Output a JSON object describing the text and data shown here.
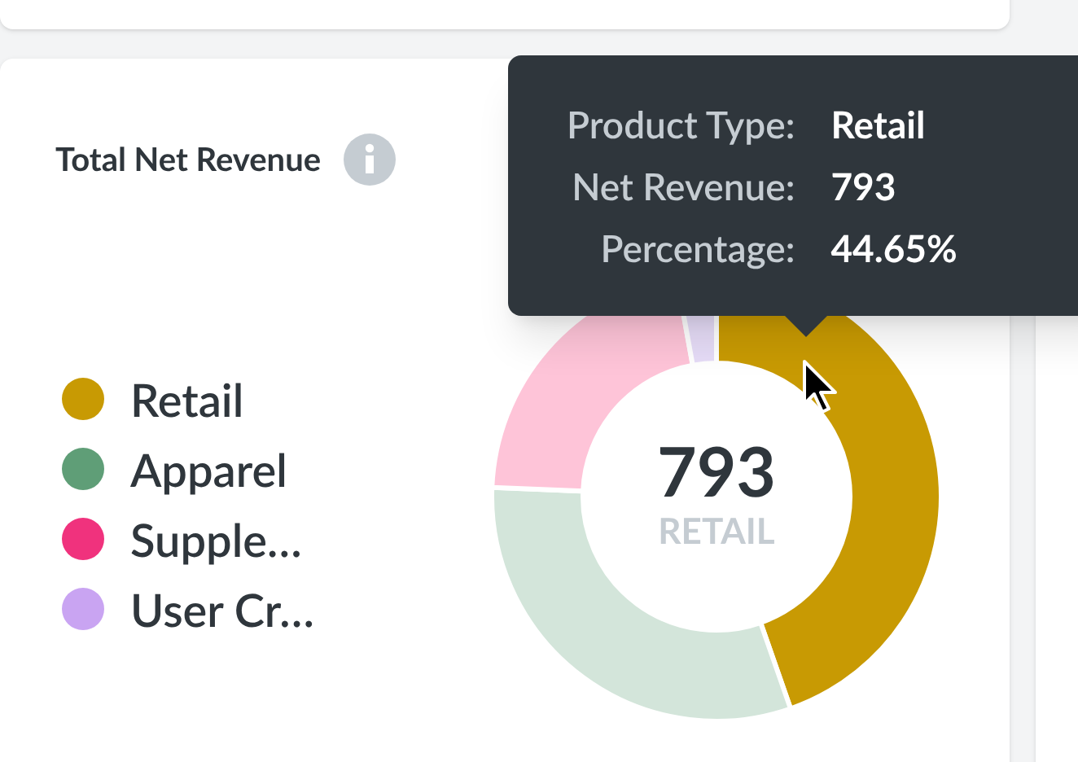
{
  "card": {
    "title": "Total Net Revenue"
  },
  "legend": [
    {
      "label": "Retail",
      "color": "#c89a03"
    },
    {
      "label": "Apparel",
      "color": "#5f9e77"
    },
    {
      "label": "Supple…",
      "color": "#f0327d"
    },
    {
      "label": "User Cr…",
      "color": "#c9a4f2"
    }
  ],
  "donut_center": {
    "value": "793",
    "label": "RETAIL"
  },
  "tooltip": {
    "rows": [
      {
        "key": "Product Type:",
        "value": "Retail"
      },
      {
        "key": "Net Revenue:",
        "value": "793"
      },
      {
        "key": "Percentage:",
        "value": "44.65%"
      }
    ]
  }
}
